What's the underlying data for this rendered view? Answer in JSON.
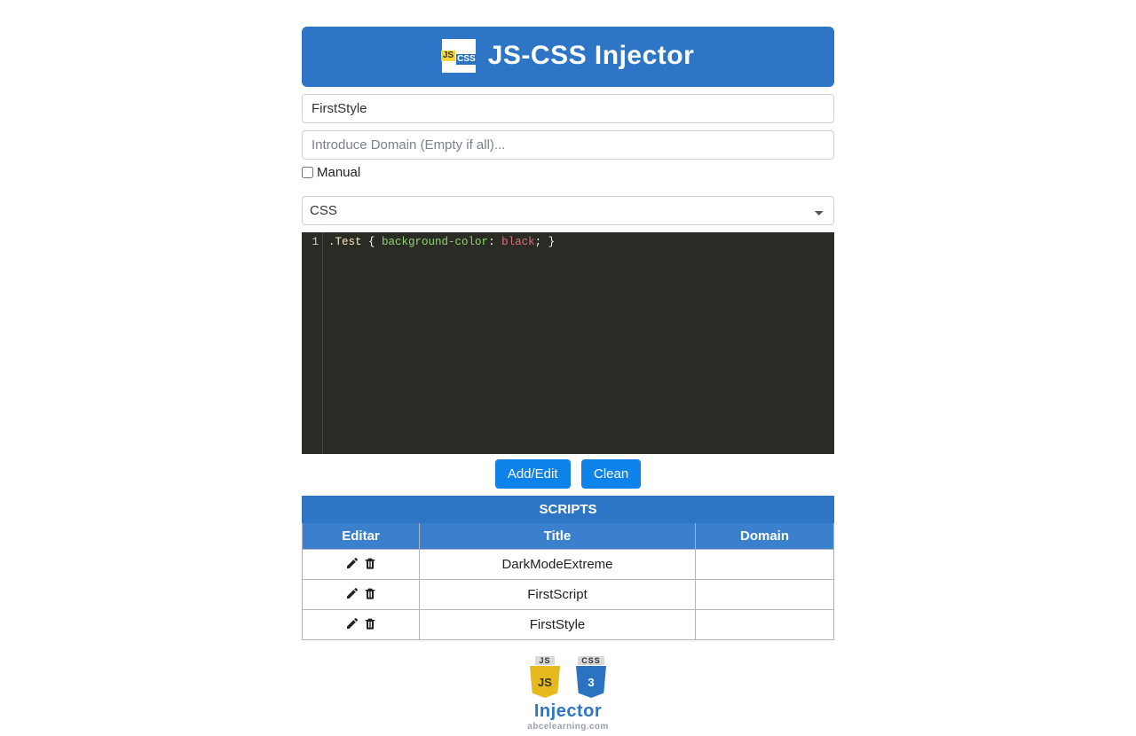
{
  "header": {
    "title": "JS-CSS Injector",
    "logo_js": "JS",
    "logo_css": "CSS"
  },
  "form": {
    "title_value": "FirstStyle",
    "domain_value": "",
    "domain_placeholder": "Introduce Domain (Empty if all)...",
    "manual_label": "Manual",
    "manual_checked": false,
    "type_selected": "CSS"
  },
  "editor": {
    "line_number": "1",
    "selector": ".Test",
    "open_brace": " { ",
    "prop": "background-color",
    "colon": ": ",
    "value": "black",
    "end": "; }"
  },
  "buttons": {
    "add_edit": "Add/Edit",
    "clean": "Clean"
  },
  "table": {
    "caption": "SCRIPTS",
    "col_editar": "Editar",
    "col_title": "Title",
    "col_domain": "Domain",
    "rows": [
      {
        "title": "DarkModeExtreme",
        "domain": ""
      },
      {
        "title": "FirstScript",
        "domain": ""
      },
      {
        "title": "FirstStyle",
        "domain": ""
      }
    ]
  },
  "footer": {
    "js_label": "JS",
    "css_label": "CSS",
    "js_shield": "JS",
    "css_shield": "3",
    "title": "Injector",
    "subtitle": "abcelearning.com"
  }
}
